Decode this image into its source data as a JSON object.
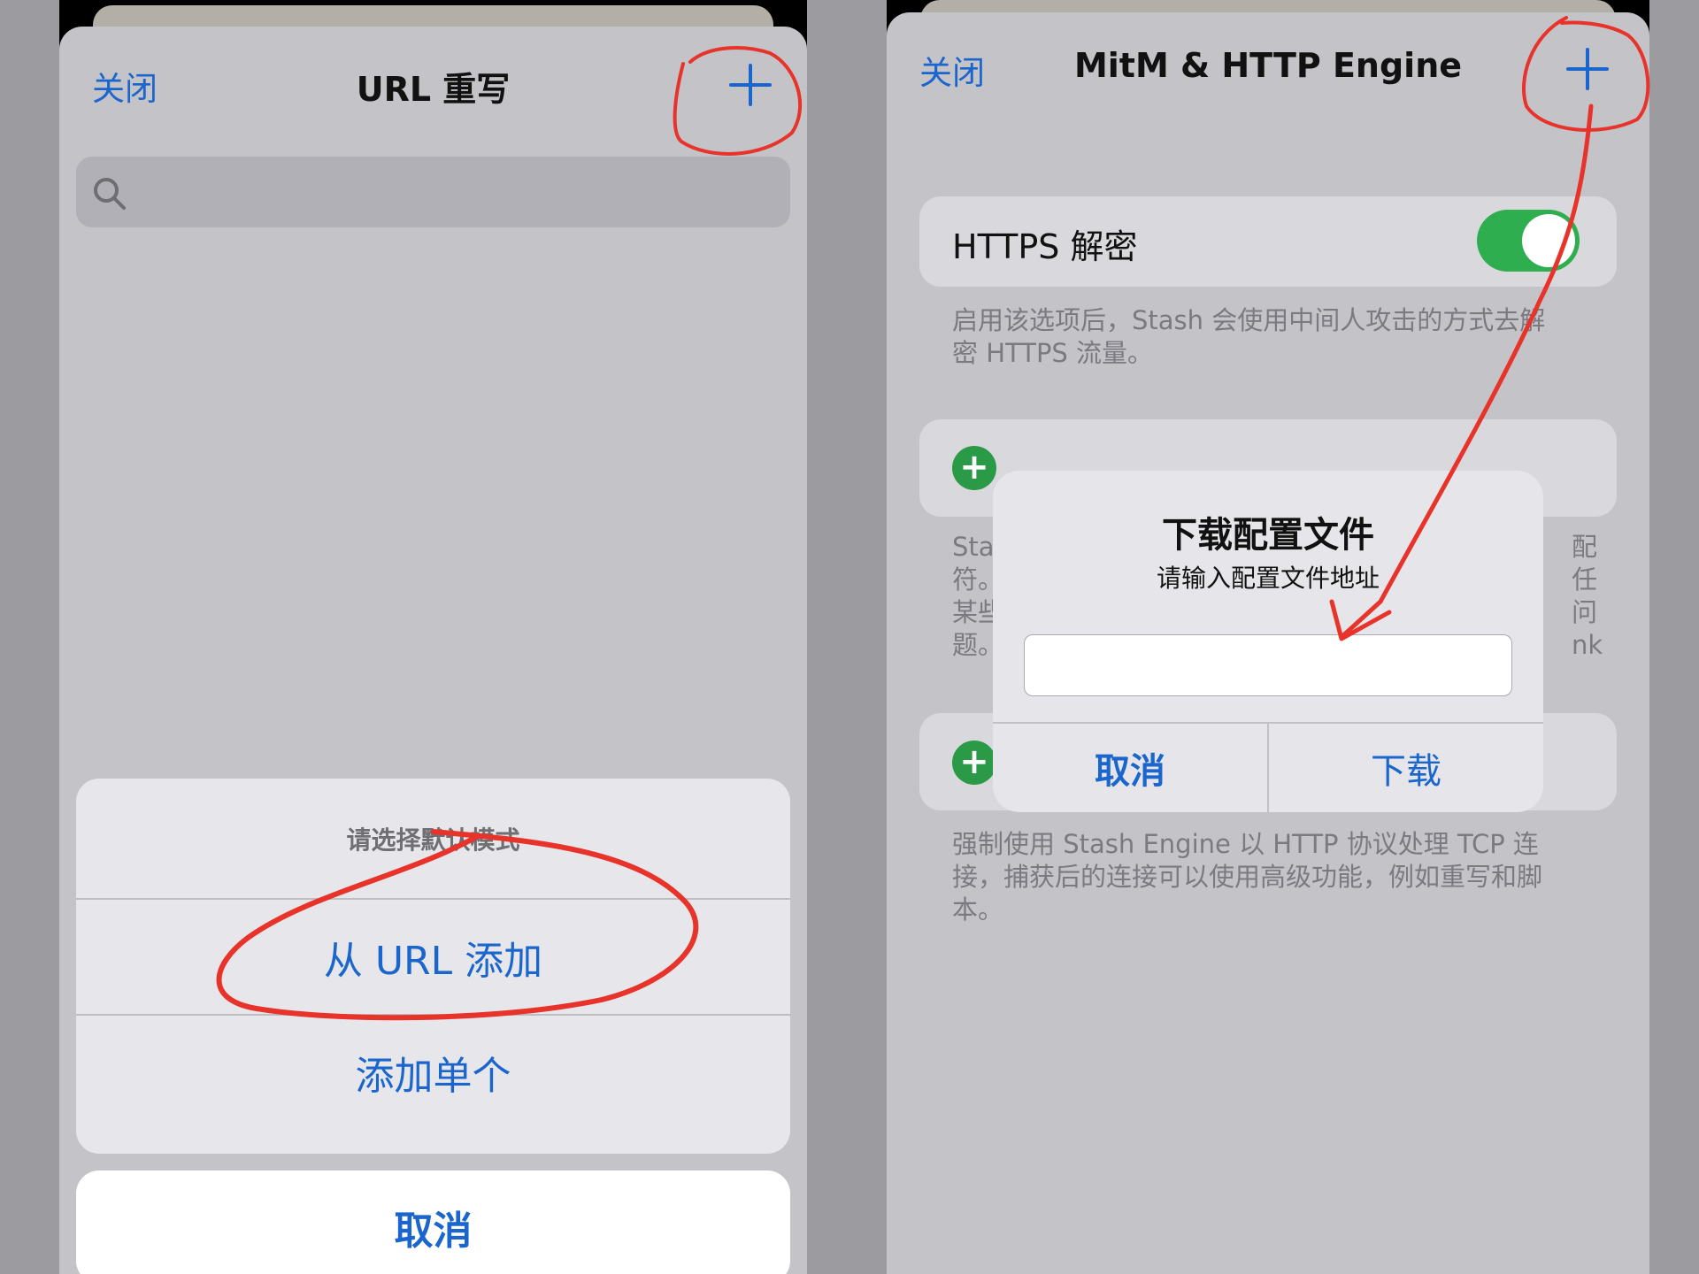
{
  "left_screen": {
    "close_label": "关闭",
    "title": "URL 重写",
    "action_sheet": {
      "header": "请选择默认模式",
      "items": [
        "从 URL 添加",
        "添加单个"
      ],
      "cancel_label": "取消"
    }
  },
  "right_screen": {
    "close_label": "关闭",
    "title": "MitM & HTTP Engine",
    "https_toggle": {
      "label": "HTTPS 解密",
      "on": true
    },
    "https_desc_line1": "启用该选项后，Stash 会使用中间人攻击的方式去解",
    "https_desc_line2": "密 HTTPS 流量。",
    "hidden_left_lines": [
      "Sta",
      "符。",
      "某些",
      "题。"
    ],
    "hidden_right_lines": [
      "配",
      "任",
      "问",
      "nk"
    ],
    "engine_desc_line1": "强制使用 Stash Engine 以 HTTP 协议处理 TCP 连",
    "engine_desc_line2": "接，捕获后的连接可以使用高级功能，例如重写和脚",
    "engine_desc_line3": "本。",
    "alert": {
      "title": "下载配置文件",
      "message": "请输入配置文件地址",
      "input_value": "",
      "cancel_label": "取消",
      "confirm_label": "下载"
    }
  },
  "colors": {
    "accent_blue": "#1a66cc",
    "toggle_green": "#2fae4f",
    "annotation_red": "#e8332a"
  },
  "icons": [
    "plus-icon",
    "search-icon"
  ]
}
